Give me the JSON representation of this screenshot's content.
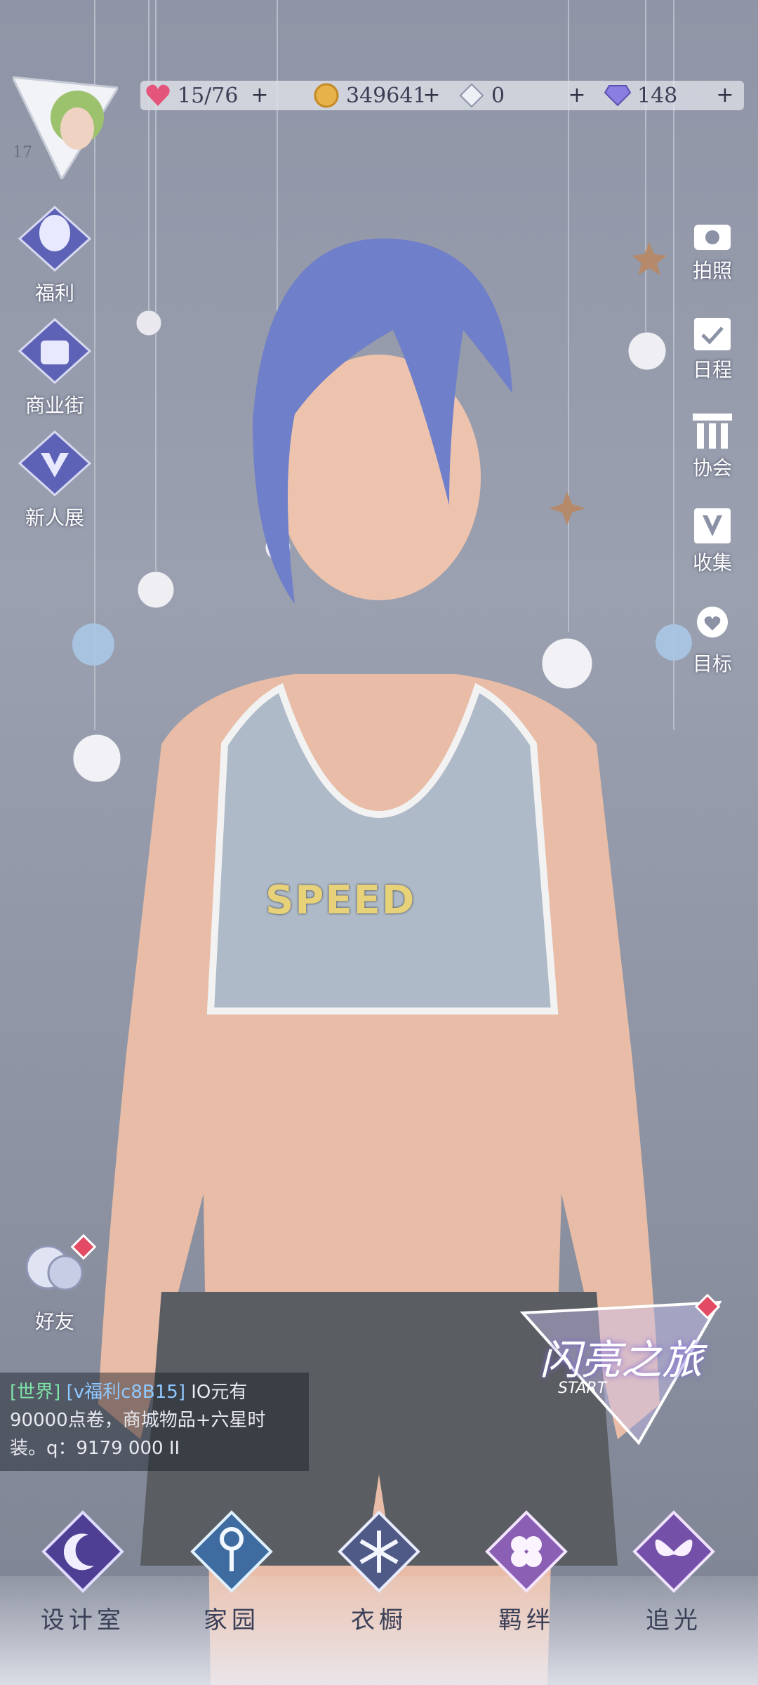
{
  "player": {
    "level": "17"
  },
  "resources": [
    {
      "icon": "heart-icon",
      "value": "15/76"
    },
    {
      "icon": "coin-icon",
      "value": "349641"
    },
    {
      "icon": "crystal-icon",
      "value": "0"
    },
    {
      "icon": "diamond-icon",
      "value": "148"
    }
  ],
  "left_menu": {
    "welfare": "福利",
    "shop": "商业街",
    "newbie": "新人展",
    "friends": "好友"
  },
  "right_menu": {
    "photo": "拍照",
    "schedule": "日程",
    "guild": "协会",
    "collect": "收集",
    "goal": "目标"
  },
  "event_banner": {
    "title": "闪亮之旅",
    "sub": "START"
  },
  "chat": {
    "channel": "[世界]",
    "sender": "[v福利c8B15]",
    "line1": "IO元有",
    "line2": "90000点卷，商城物品+六星时",
    "line3": "装。q：9179 000 II"
  },
  "bottom_nav": [
    {
      "label": "设计室",
      "icon": "moon-icon"
    },
    {
      "label": "家园",
      "icon": "key-icon"
    },
    {
      "label": "衣橱",
      "icon": "snowflake-icon"
    },
    {
      "label": "羁绊",
      "icon": "clover-icon"
    },
    {
      "label": "追光",
      "icon": "butterfly-icon"
    }
  ],
  "outfit_text": "SPEED",
  "colors": {
    "accent": "#e24b63",
    "hair": "#6f7fc9",
    "bg": "#9aa0af"
  }
}
